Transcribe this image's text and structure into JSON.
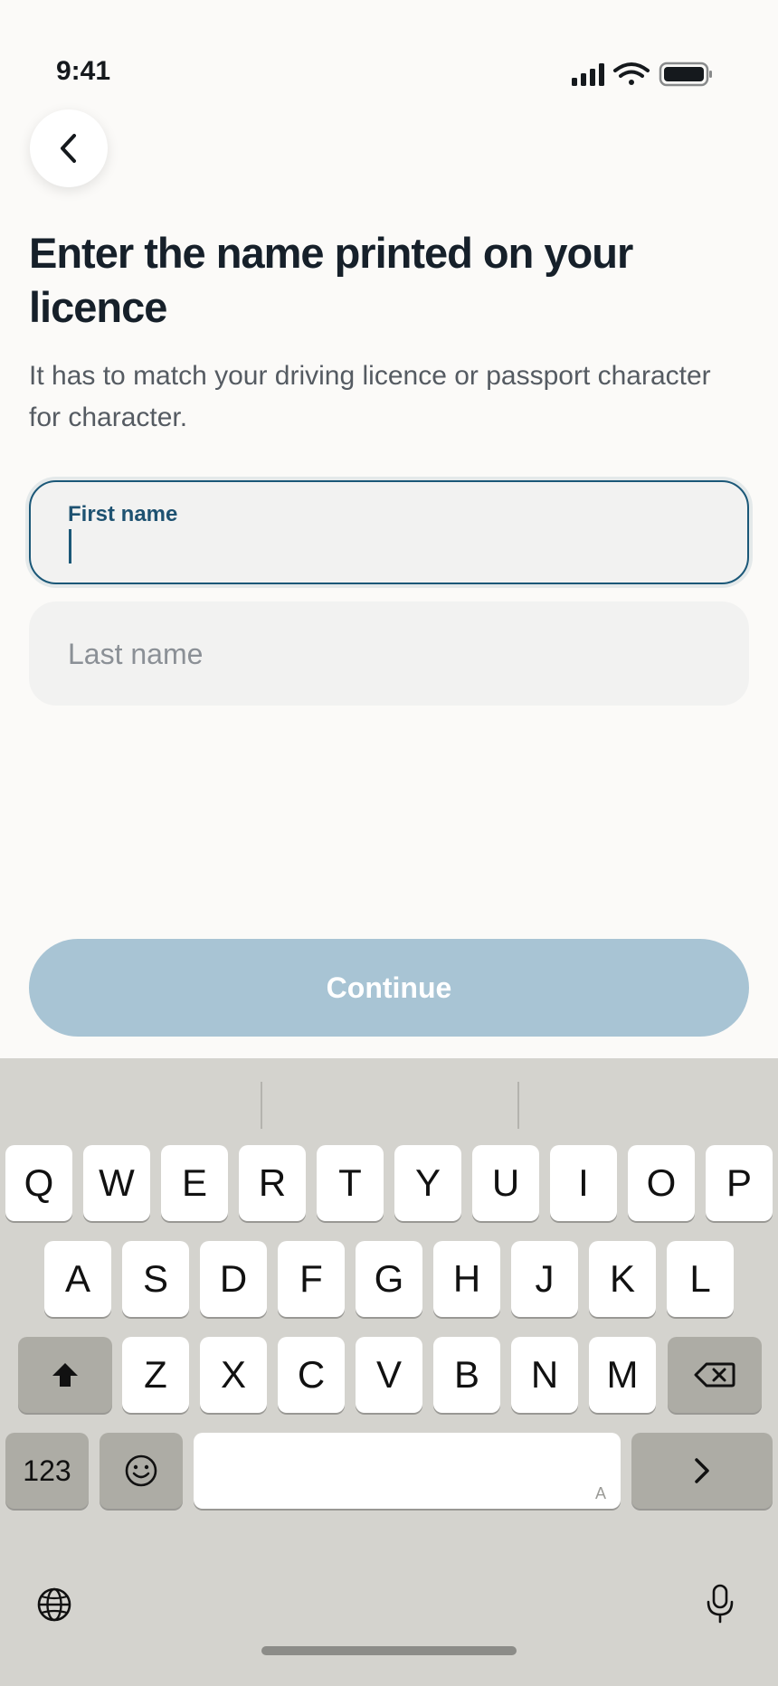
{
  "status": {
    "time": "9:41"
  },
  "heading": {
    "title": "Enter the name printed on your licence",
    "subtitle": "It has to match your driving licence or passport character for character."
  },
  "form": {
    "first_name": {
      "label": "First name",
      "value": ""
    },
    "last_name": {
      "placeholder": "Last name",
      "value": ""
    }
  },
  "actions": {
    "continue_label": "Continue"
  },
  "colors": {
    "accent": "#1b5878",
    "continue_disabled": "#A8C4D4",
    "background": "#FBFAF8",
    "keyboard_bg": "#D4D3CE"
  },
  "keyboard": {
    "row1": [
      "Q",
      "W",
      "E",
      "R",
      "T",
      "Y",
      "U",
      "I",
      "O",
      "P"
    ],
    "row2": [
      "A",
      "S",
      "D",
      "F",
      "G",
      "H",
      "J",
      "K",
      "L"
    ],
    "row3": [
      "Z",
      "X",
      "C",
      "V",
      "B",
      "N",
      "M"
    ],
    "numbers_label": "123",
    "space_hint": "A",
    "icons": {
      "shift": "shift-icon",
      "delete": "backspace-icon",
      "emoji": "emoji-icon",
      "next": "chevron-right-icon",
      "globe": "globe-icon",
      "mic": "microphone-icon"
    }
  }
}
